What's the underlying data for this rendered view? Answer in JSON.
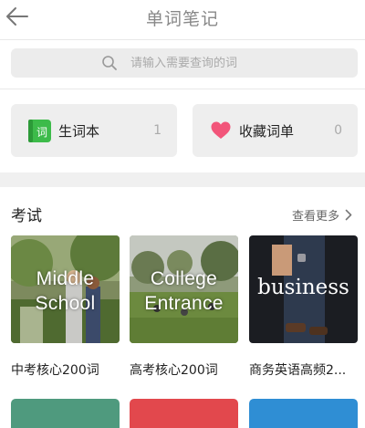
{
  "header": {
    "title": "单词笔记",
    "back_icon": "arrow-left-icon"
  },
  "search": {
    "placeholder": "请输入需要查询的词",
    "icon": "search-icon"
  },
  "cards": {
    "vocab_book": {
      "label": "生词本",
      "count": "1",
      "icon": "notebook-icon",
      "icon_badge": "词",
      "icon_color": "#3dbb4a"
    },
    "favorites": {
      "label": "收藏词单",
      "count": "0",
      "icon": "heart-icon",
      "icon_color": "#f2557a"
    }
  },
  "exam_section": {
    "title": "考试",
    "see_more": "查看更多",
    "see_more_icon": "chevron-right-icon",
    "books": [
      {
        "cover_line1": "Middle",
        "cover_line2": "School",
        "title": "中考核心200词"
      },
      {
        "cover_line1": "College",
        "cover_line2": "Entrance",
        "title": "高考核心200词"
      },
      {
        "cover_line1": "business",
        "title": "商务英语高频2..."
      }
    ]
  },
  "colors": {
    "tile_green": "#4f9a7e",
    "tile_red": "#e2484d",
    "tile_blue": "#2f8ed4"
  }
}
